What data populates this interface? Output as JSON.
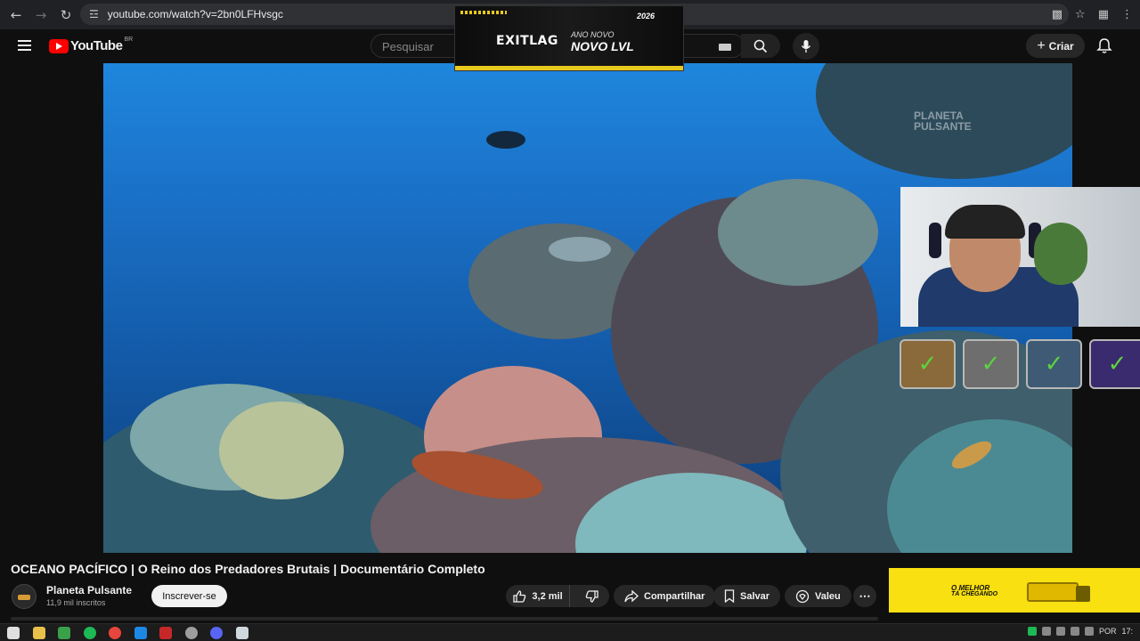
{
  "browser": {
    "url": "youtube.com/watch?v=2bn0LFHvsgc",
    "back_icon": "←",
    "forward_icon": "→",
    "reload_icon": "↻",
    "tune_icon": "☲"
  },
  "exitlag_overlay": {
    "brand": "EXITLAG",
    "line1": "ANO NOVO",
    "line2": "NOVO LVL",
    "tag": "2026"
  },
  "youtube": {
    "logo_text": "YouTube",
    "country_code": "BR",
    "search_placeholder": "Pesquisar",
    "create_label": "Criar",
    "create_icon": "+"
  },
  "video": {
    "watermark_line1": "PLANETA",
    "watermark_line2": "PULSANTE",
    "title": "OCEANO PACÍFICO | O Reino dos Predadores Brutais | Documentário Completo",
    "channel_name": "Planeta Pulsante",
    "subscribers": "11,9 mil inscritos",
    "subscribe_label": "Inscrever-se",
    "like_count": "3,2 mil",
    "share_label": "Compartilhar",
    "save_label": "Salvar",
    "thanks_label": "Valeu",
    "more_label": "⋯"
  },
  "overlay_tiles": [
    {
      "check": "✓",
      "color": "#8a6a3a"
    },
    {
      "check": "✓",
      "color": "#6e6e6e"
    },
    {
      "check": "✓",
      "color": "#3e5a74"
    },
    {
      "check": "✓",
      "color": "#3a2a6e"
    }
  ],
  "ad": {
    "line1": "O MELHOR",
    "line2": "TÁ CHEGANDO"
  },
  "taskbar": {
    "language": "POR",
    "time": "17:"
  },
  "colors": {
    "accent_red": "#ff0000",
    "ad_yellow": "#f8e011",
    "check_green": "#5cd23f"
  }
}
